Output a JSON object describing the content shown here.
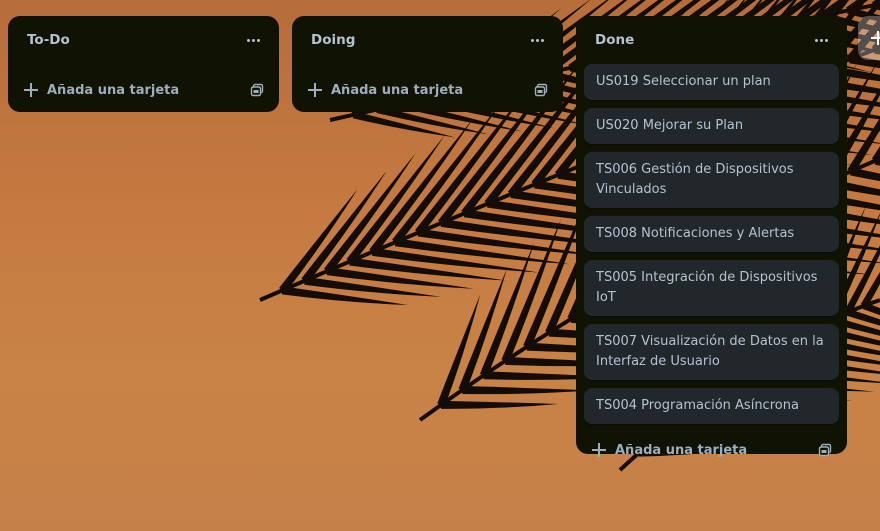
{
  "board": {
    "background_colors": {
      "sky": "#c57a41",
      "palm": "#140c07"
    },
    "lists": [
      {
        "title": "To-Do",
        "cards": [],
        "add_card_label": "Añada una tarjeta"
      },
      {
        "title": "Doing",
        "cards": [],
        "add_card_label": "Añada una tarjeta"
      },
      {
        "title": "Done",
        "cards": [
          "US019 Seleccionar un plan",
          "US020 Mejorar su Plan",
          "TS006 Gestión de Dispositivos Vinculados",
          "TS008 Notificaciones y Alertas",
          "TS005 Integración de Dispositivos IoT",
          "TS007 Visualización de Datos en la Interfaz de Usuario",
          "TS004 Programación Asíncrona"
        ],
        "add_card_label": "Añada una tarjeta"
      }
    ]
  },
  "icons": {
    "list_menu": "more-horizontal-icon",
    "add": "plus-icon",
    "template": "card-template-icon",
    "add_list": "plus-icon"
  },
  "colors": {
    "list_bg": "#101204",
    "card_bg": "#22272b",
    "text": "#b6c2cf"
  }
}
